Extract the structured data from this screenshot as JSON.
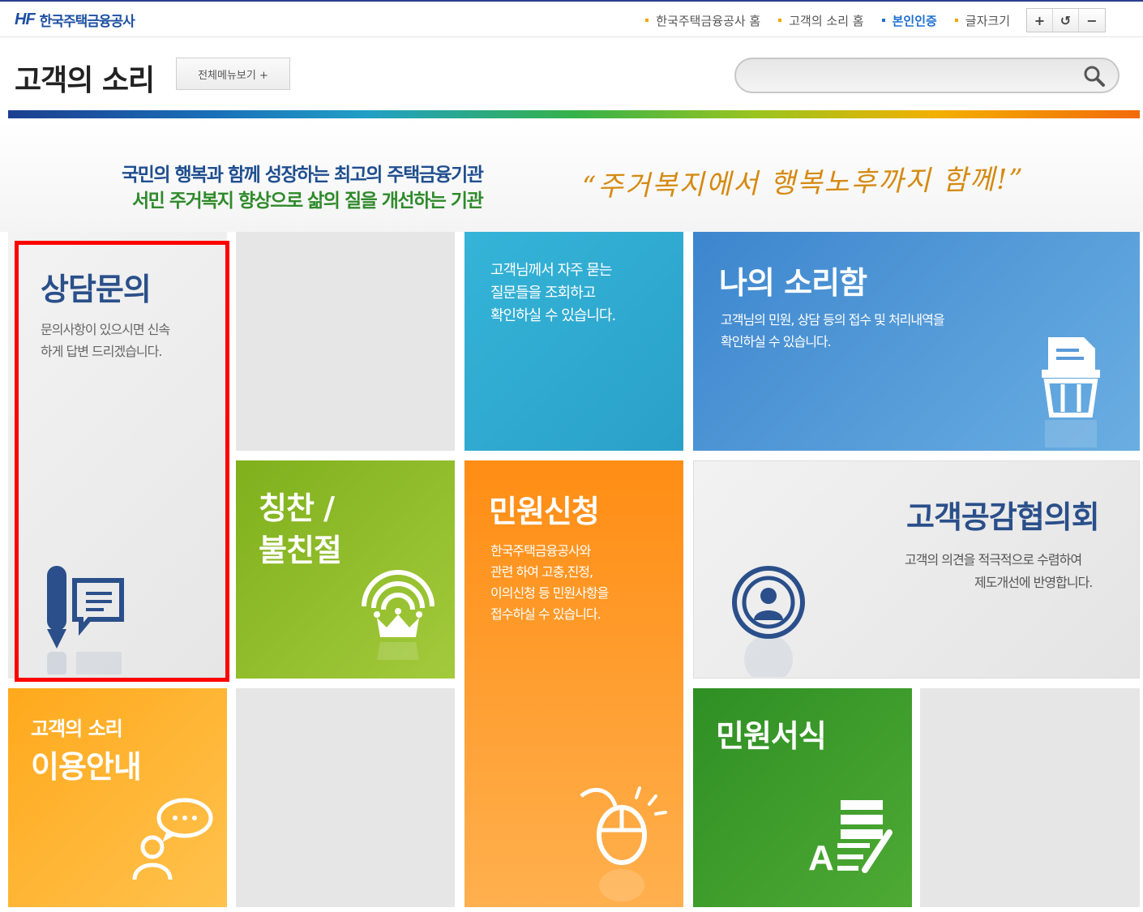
{
  "topbar": {
    "logo_mark": "HF",
    "org_name": "한국주택금융공사",
    "links": [
      "한국주택금융공사 홈",
      "고객의 소리 홈",
      "본인인증",
      "글자크기"
    ],
    "font_buttons": [
      "+",
      "↺",
      "−"
    ]
  },
  "header": {
    "title": "고객의 소리",
    "all_menu": "전체메뉴보기 +",
    "search_placeholder": ""
  },
  "hero": {
    "line1": "국민의 행복과 함께 성장하는 최고의 주택금융기관",
    "line2": "서민 주거복지 향상으로 삶의 질을 개선하는 기관",
    "slogan": "“주거복지에서 행복노후까지 함께!”"
  },
  "tiles": {
    "consult": {
      "title": "상담문의",
      "desc1": "문의사항이 있으시면 신속",
      "desc2": "하게 답변 드리겠습니다."
    },
    "faq": {
      "desc1": "고객님께서 자주 묻는",
      "desc2": "질문들을 조회하고",
      "desc3": "확인하실 수 있습니다."
    },
    "mybox": {
      "title": "나의 소리함",
      "desc1": "고객님의 민원, 상담 등의 접수 및 처리내역을",
      "desc2": "확인하실 수 있습니다."
    },
    "praise": {
      "title1": "칭찬 /",
      "title2": "불친절"
    },
    "petition": {
      "title": "민원신청",
      "desc1": "한국주택금융공사와",
      "desc2": "관련 하여 고충,진정,",
      "desc3": "이의신청 등 민원사항을",
      "desc4": "접수하실 수 있습니다."
    },
    "council": {
      "title": "고객공감협의회",
      "desc1": "고객의 의견을 적극적으로 수렴하여",
      "desc2": "제도개선에 반영합니다."
    },
    "guide": {
      "title1": "고객의 소리",
      "title2": "이용안내"
    },
    "forms": {
      "title": "민원서식"
    }
  },
  "colors": {
    "consult_bg": "#eeeeee",
    "faq_bg": "#2eaed4",
    "mybox_bg": "#4f98d8",
    "praise_bg": "#8cbc2a",
    "petition_bg": "#ff9a24",
    "council_bg": "#ececec",
    "guide_bg": "#ffb327",
    "forms_bg": "#3c9a2c",
    "highlight": "#ff0000"
  }
}
